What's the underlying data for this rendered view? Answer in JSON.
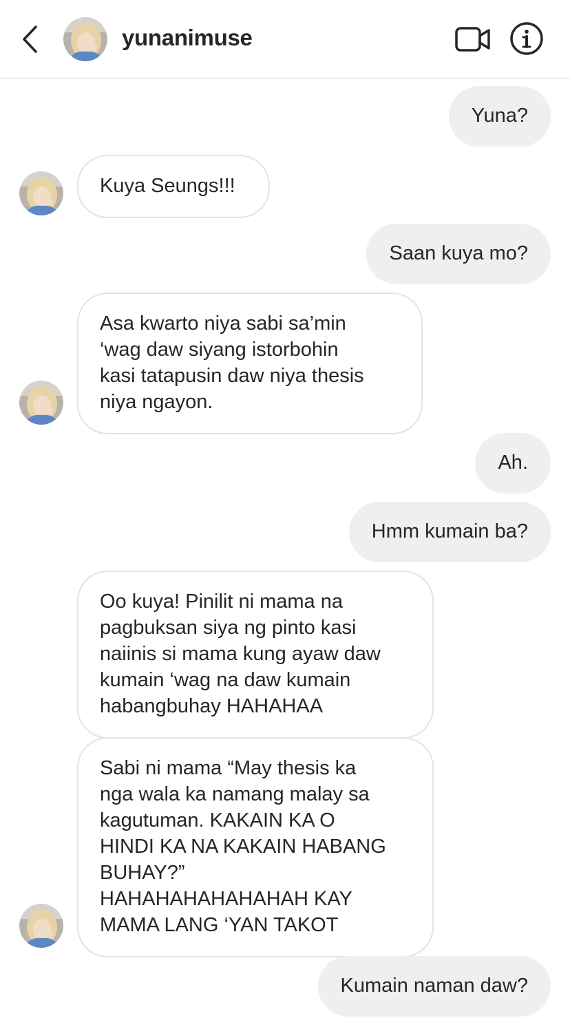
{
  "header": {
    "username": "yunanimuse",
    "back_icon": "chevron-left-icon",
    "video_icon": "video-camera-icon",
    "info_icon": "info-icon"
  },
  "messages": [
    {
      "direction": "sent",
      "text": "Yuna?"
    },
    {
      "direction": "received",
      "text": "Kuya Seungs!!!"
    },
    {
      "direction": "sent",
      "text": "Saan kuya mo?"
    },
    {
      "direction": "received",
      "text": "Asa kwarto niya sabi sa’min\n‘wag daw siyang istorbohin\nkasi tatapusin daw niya thesis\nniya ngayon."
    },
    {
      "direction": "sent",
      "text": "Ah."
    },
    {
      "direction": "sent",
      "text": "Hmm kumain ba?"
    },
    {
      "direction": "received",
      "text": "Oo kuya! Pinilit ni mama na\npagbuksan siya ng pinto kasi\nnaiinis si mama kung ayaw daw\nkumain ‘wag na daw kumain\nhabangbuhay HAHAHAA"
    },
    {
      "direction": "received",
      "text": "Sabi ni mama “May thesis ka\nnga wala ka namang malay sa\nkagutuman. KAKAIN KA O\nHINDI KA NA KAKAIN HABANG\nBUHAY?”\nHAHAHAHAHAHAHAH KAY\nMAMA LANG ‘YAN TAKOT"
    },
    {
      "direction": "sent",
      "text": "Kumain naman daw?"
    }
  ],
  "colors": {
    "sent_bubble": "#efefef",
    "received_border": "#e3e3e3",
    "text": "#262626",
    "divider": "#d3d3d3"
  }
}
